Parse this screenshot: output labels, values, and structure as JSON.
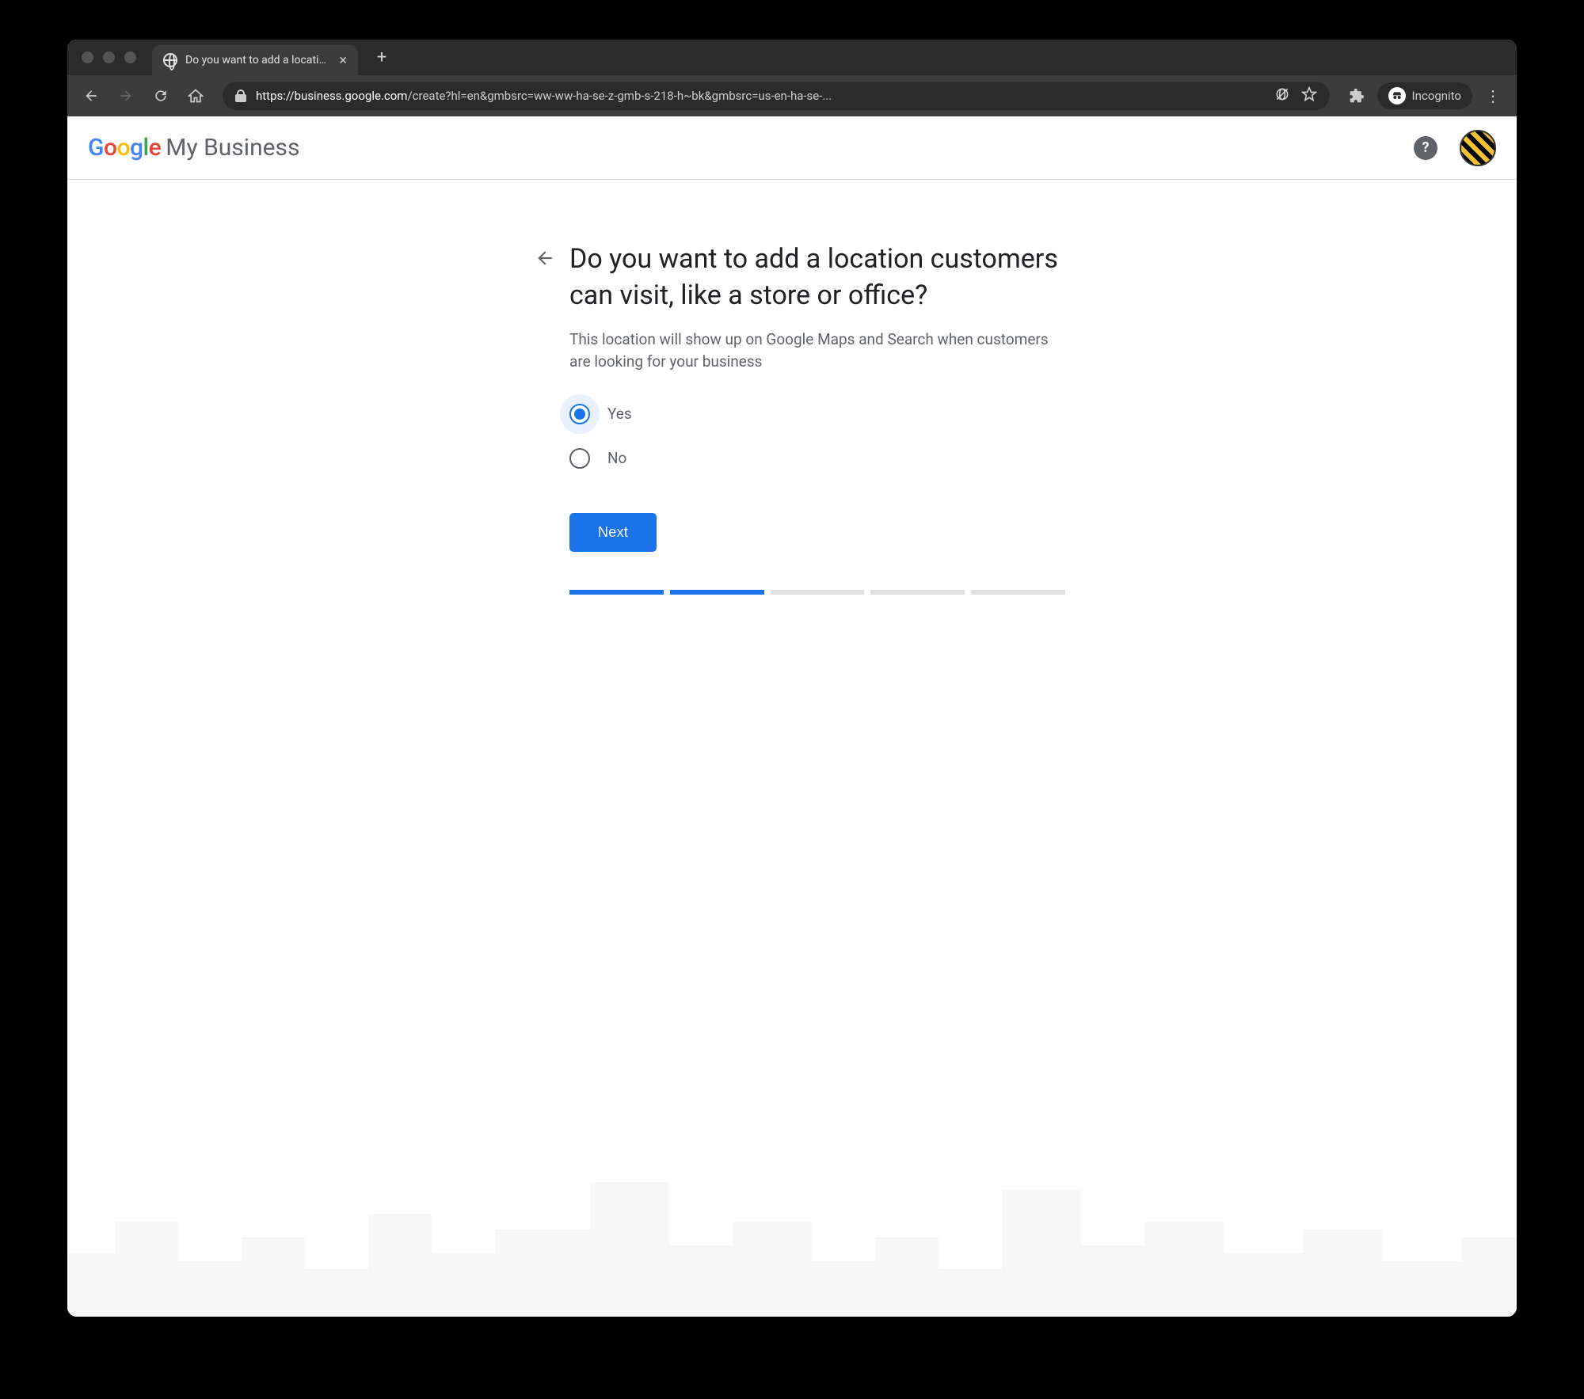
{
  "browser": {
    "tab_title": "Do you want to add a location c",
    "url_prefix": "https://",
    "url_host": "business.google.com",
    "url_path": "/create?hl=en&gmbsrc=ww-ww-ha-se-z-gmb-s-218-h~bk&gmbsrc=us-en-ha-se-...",
    "incognito_label": "Incognito"
  },
  "header": {
    "google": "Google",
    "product": "My Business",
    "help": "?"
  },
  "form": {
    "question": "Do you want to add a location customers can visit, like a store or office?",
    "sub": "This location will show up on Google Maps and Search when customers are looking for your business",
    "option_yes": "Yes",
    "option_no": "No",
    "selected": "yes",
    "next_label": "Next",
    "progress_total": 5,
    "progress_done": 2
  }
}
